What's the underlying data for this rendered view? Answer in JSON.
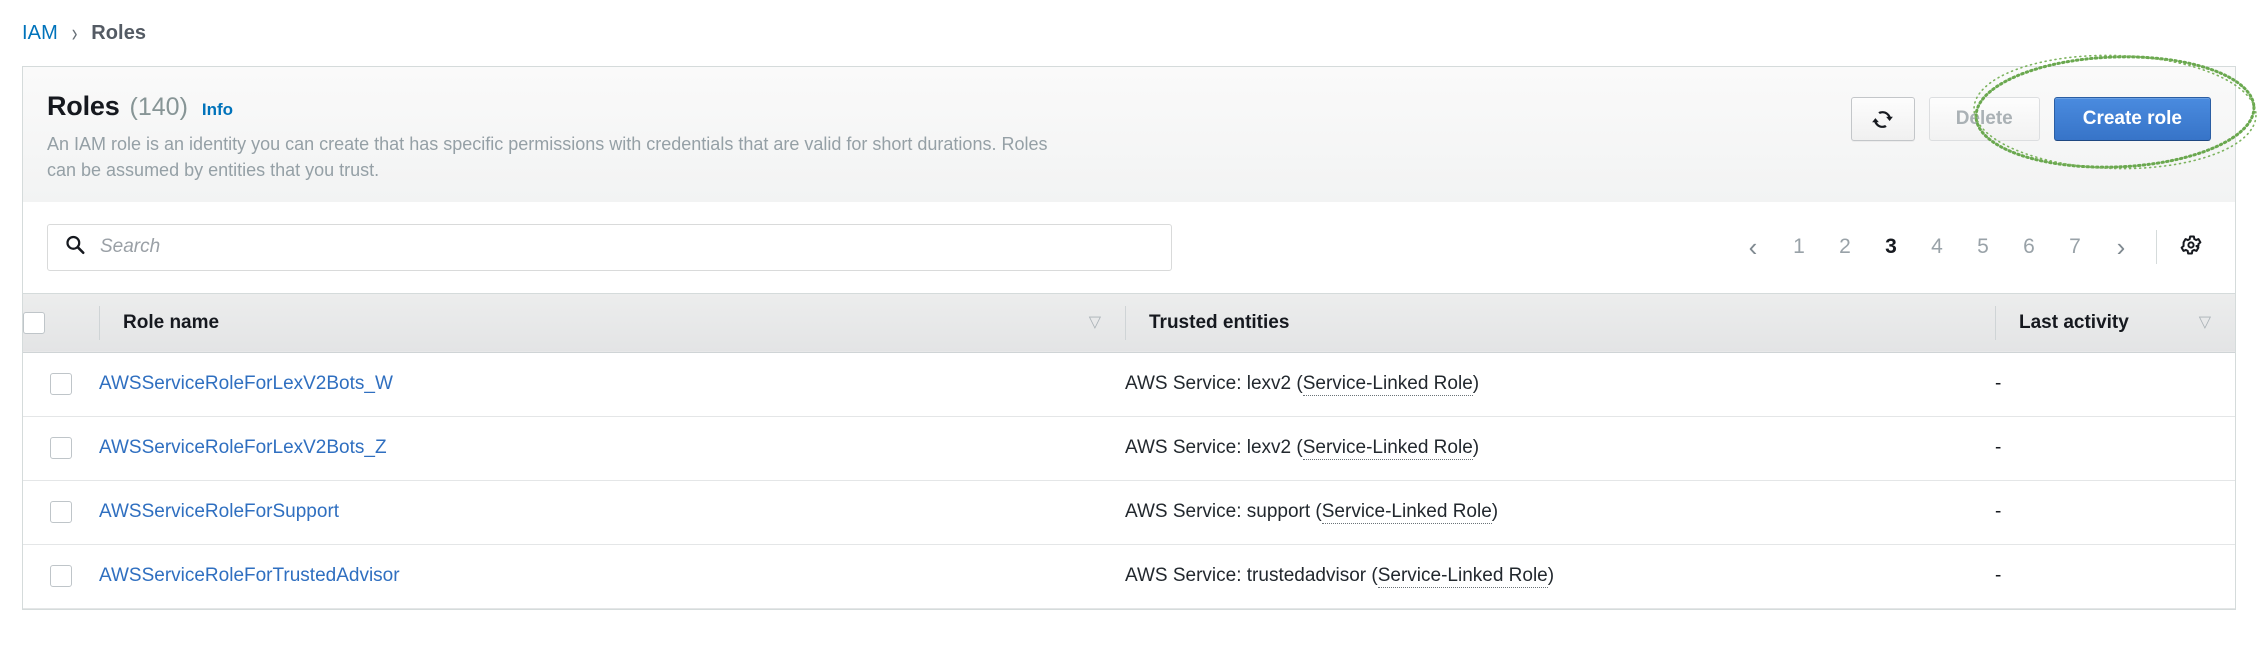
{
  "breadcrumb": {
    "root": "IAM",
    "separator": "›",
    "current": "Roles"
  },
  "header": {
    "title": "Roles",
    "count": "(140)",
    "info_label": "Info",
    "description": "An IAM role is an identity you can create that has specific permissions with credentials that are valid for short durations. Roles can be assumed by entities that you trust."
  },
  "actions": {
    "refresh_icon": "refresh-icon",
    "delete_label": "Delete",
    "create_label": "Create role"
  },
  "annotation": {
    "shape": "ellipse",
    "target": "Create role",
    "color": "#6aa84f",
    "style": "dotted"
  },
  "search": {
    "icon": "search-icon",
    "placeholder": "Search",
    "value": ""
  },
  "pagination": {
    "prev_icon": "‹",
    "next_icon": "›",
    "pages": [
      "1",
      "2",
      "3",
      "4",
      "5",
      "6",
      "7"
    ],
    "active_page": "3",
    "settings_icon": "gear-icon"
  },
  "table": {
    "columns": [
      {
        "key": "select",
        "label": "",
        "sortable": false
      },
      {
        "key": "name",
        "label": "Role name",
        "sortable": true
      },
      {
        "key": "trusted",
        "label": "Trusted entities",
        "sortable": false
      },
      {
        "key": "activity",
        "label": "Last activity",
        "sortable": true
      }
    ],
    "sort_caret": "▽",
    "rows": [
      {
        "name": "AWSServiceRoleForLexV2Bots_W",
        "trusted_prefix": "AWS Service: lexv2 (",
        "trusted_link": "Service-Linked Role",
        "trusted_suffix": ")",
        "activity": "-"
      },
      {
        "name": "AWSServiceRoleForLexV2Bots_Z",
        "trusted_prefix": "AWS Service: lexv2 (",
        "trusted_link": "Service-Linked Role",
        "trusted_suffix": ")",
        "activity": "-"
      },
      {
        "name": "AWSServiceRoleForSupport",
        "trusted_prefix": "AWS Service: support (",
        "trusted_link": "Service-Linked Role",
        "trusted_suffix": ")",
        "activity": "-"
      },
      {
        "name": "AWSServiceRoleForTrustedAdvisor",
        "trusted_prefix": "AWS Service: trustedadvisor (",
        "trusted_link": "Service-Linked Role",
        "trusted_suffix": ")",
        "activity": "-"
      }
    ]
  },
  "colors": {
    "link": "#0073bb",
    "row_link": "#2f6fc0",
    "primary_button": "#3b7dd8",
    "annotation_green": "#6aa84f",
    "muted_text": "#95a0a6"
  }
}
